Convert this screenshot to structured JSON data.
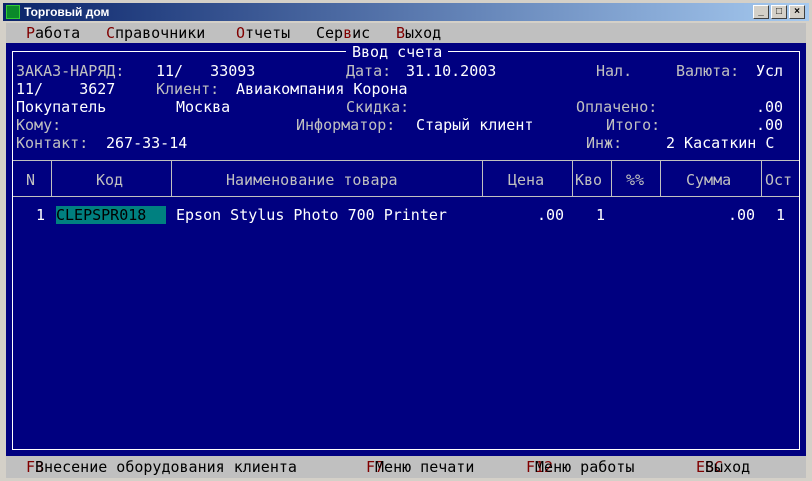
{
  "window": {
    "title": "Торговый дом",
    "minimize": "_",
    "maximize": "□",
    "close": "×"
  },
  "menu": [
    {
      "hotkey": "Р",
      "rest": "абота"
    },
    {
      "hotkey": "С",
      "rest": "правочники"
    },
    {
      "hotkey": "О",
      "rest": "тчеты"
    },
    {
      "pre": "Сер",
      "hotkey": "в",
      "rest": "ис"
    },
    {
      "hotkey": "В",
      "rest": "ыход"
    }
  ],
  "form": {
    "title": "Ввод счета",
    "order_label": "ЗАКАЗ-НАРЯД:",
    "order_value": "11/   33093",
    "date_label": "Дата:",
    "date_value": "31.10.2003",
    "payment": "Нал.",
    "currency_label": "Валюта:",
    "currency_value": "Усл",
    "sub_number": "11/    3627",
    "client_label": "Клиент:",
    "client_value": "Авиакомпания Корона",
    "buyer": "Покупатель",
    "city": "Москва",
    "discount_label": "Скидка:",
    "paid_label": "Оплачено:",
    "paid_value": ".00",
    "to_label": "Кому:",
    "informer_label": "Информатор:",
    "informer_value": "Старый клиент",
    "total_label": "Итого:",
    "total_value": ".00",
    "contact_label": "Контакт:",
    "contact_value": "267-33-14",
    "engineer_label": "Инж:",
    "engineer_value": "2 Касаткин С"
  },
  "table": {
    "columns": [
      "N",
      "Код",
      "Наименование товара",
      "Цена",
      "Кво",
      "%%",
      "Сумма",
      "Ост"
    ],
    "rows": [
      {
        "n": "1",
        "code": "CLEPSPR018",
        "name": "Epson Stylus Photo 700 Printer",
        "price": ".00",
        "qty": "1",
        "pct": "",
        "sum": ".00",
        "rest": "1"
      }
    ]
  },
  "status": [
    {
      "key": "F3",
      "label": "Внесение оборудования клиента"
    },
    {
      "key": "F7",
      "label": "Меню печати"
    },
    {
      "key": "F12",
      "label": "Меню работы"
    },
    {
      "key": "ESC",
      "label": "Выход"
    }
  ],
  "colors": {
    "background": "#000080",
    "hotkey": "#800000",
    "highlight": "#008080"
  }
}
